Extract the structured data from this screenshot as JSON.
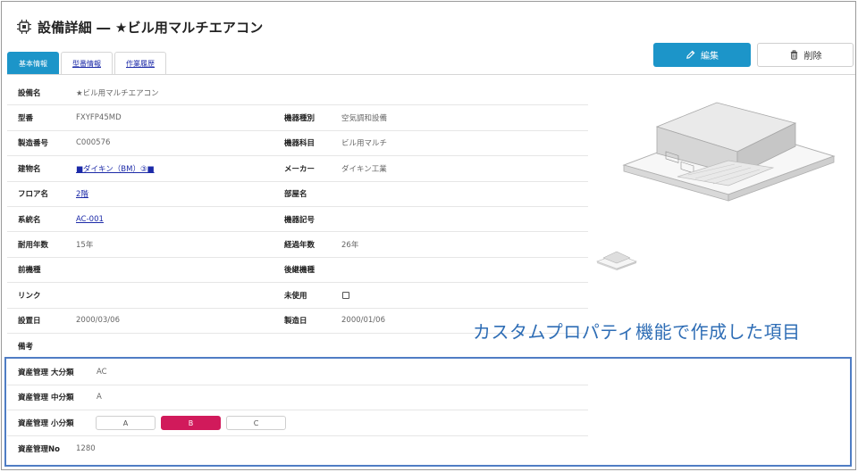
{
  "header": {
    "title": "設備詳細 ― ★ビル用マルチエアコン"
  },
  "tabs": [
    {
      "label": "基本情報"
    },
    {
      "label": "型番情報"
    },
    {
      "label": "作業履歴"
    }
  ],
  "actions": {
    "edit_label": "編集",
    "delete_label": "削除"
  },
  "fields": {
    "equipment_name": {
      "label": "設備名",
      "value": "★ビル用マルチエアコン"
    },
    "model": {
      "label": "型番",
      "value": "FXYFP45MD"
    },
    "type": {
      "label": "機器種別",
      "value": "空気調和設備"
    },
    "serial": {
      "label": "製造番号",
      "value": "C000576"
    },
    "category": {
      "label": "機器科目",
      "value": "ビル用マルチ"
    },
    "building": {
      "label": "建物名",
      "value": "■ダイキン（BM）③■"
    },
    "maker": {
      "label": "メーカー",
      "value": "ダイキン工業"
    },
    "floor": {
      "label": "フロア名",
      "value": "2階"
    },
    "room": {
      "label": "部屋名",
      "value": ""
    },
    "system": {
      "label": "系統名",
      "value": "AC-001"
    },
    "symbol": {
      "label": "機器記号",
      "value": ""
    },
    "service_life": {
      "label": "耐用年数",
      "value": "15年"
    },
    "elapsed": {
      "label": "経過年数",
      "value": "26年"
    },
    "predecessor": {
      "label": "前機種",
      "value": ""
    },
    "successor": {
      "label": "後継機種",
      "value": ""
    },
    "link": {
      "label": "リンク",
      "value": ""
    },
    "unused": {
      "label": "未使用"
    },
    "install_date": {
      "label": "設置日",
      "value": "2000/03/06"
    },
    "manufacture_date": {
      "label": "製造日",
      "value": "2000/01/06"
    },
    "notes": {
      "label": "備考",
      "value": ""
    }
  },
  "callout": "カスタムプロパティ機能で作成した項目",
  "custom": {
    "asset_major": {
      "label": "資産管理 大分類",
      "value": "AC"
    },
    "asset_middle": {
      "label": "資産管理 中分類",
      "value": "A"
    },
    "asset_minor": {
      "label": "資産管理 小分類",
      "options": [
        "A",
        "B",
        "C"
      ],
      "selected": "B"
    },
    "asset_no": {
      "label": "資産管理No",
      "value": "1280"
    }
  },
  "colors": {
    "accent": "#1c95c9",
    "link": "#1c2aa8",
    "selected": "#d11a5b",
    "callout": "#2e6db5"
  }
}
